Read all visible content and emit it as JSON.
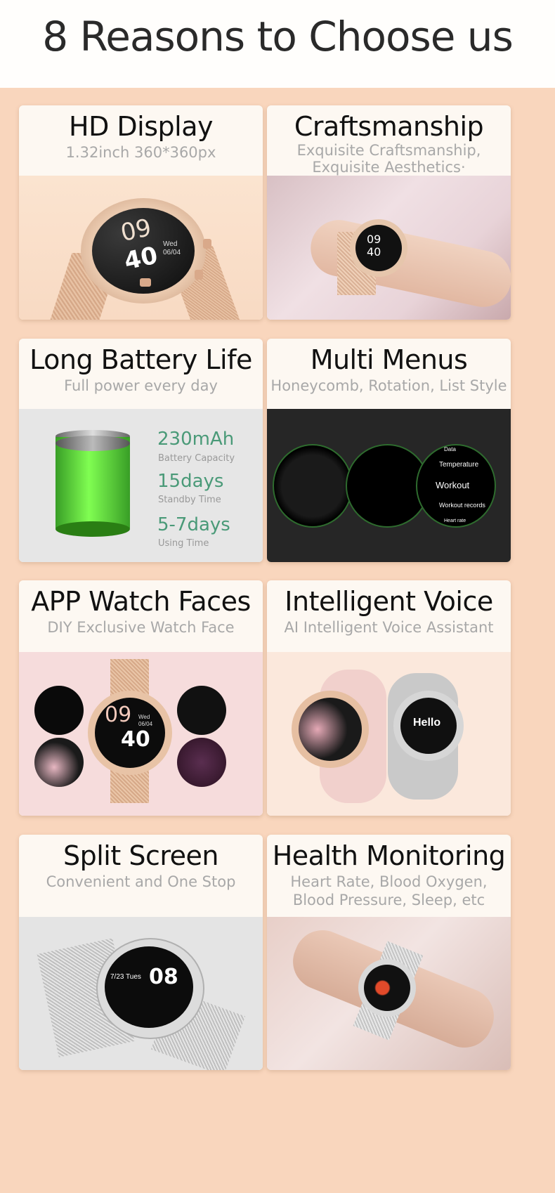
{
  "page": {
    "title": "8 Reasons to Choose us"
  },
  "cards": [
    {
      "title": "HD Display",
      "subtitle": "1.32inch  360*360px",
      "watch_face": {
        "hour": "09",
        "minute": "40",
        "day": "Wed",
        "date": "06/04"
      }
    },
    {
      "title": "Craftsmanship",
      "subtitle_lines": [
        "Exquisite Craftsmanship,",
        "Exquisite Aesthetics·"
      ]
    },
    {
      "title": "Long Battery Life",
      "subtitle": "Full power every day",
      "stats": [
        {
          "value": "230mAh",
          "label": "Battery Capacity"
        },
        {
          "value": "15days",
          "label": "Standby Time"
        },
        {
          "value": "5-7days",
          "label": "Using Time"
        }
      ],
      "accent": "#4a9a78"
    },
    {
      "title": "Multi Menus",
      "subtitle": "Honeycomb, Rotation, List Style",
      "list_menu": [
        "Data",
        "Temperature",
        "Workout",
        "Workout records",
        "Heart rate"
      ]
    },
    {
      "title": "APP Watch Faces",
      "subtitle": "DIY Exclusive Watch Face",
      "watch_face": {
        "hour": "09",
        "minute": "40",
        "day": "Wed",
        "date": "06/04"
      }
    },
    {
      "title": "Intelligent Voice",
      "subtitle": "AI Intelligent Voice Assistant",
      "screen_text": "Hello"
    },
    {
      "title": "Split Screen",
      "subtitle": "Convenient and One Stop",
      "screen_time": "08",
      "screen_date": "7/23 Tues"
    },
    {
      "title": "Health Monitoring",
      "subtitle_lines": [
        "Heart Rate, Blood Oxygen,",
        "Blood Pressure, Sleep, etc"
      ]
    }
  ]
}
